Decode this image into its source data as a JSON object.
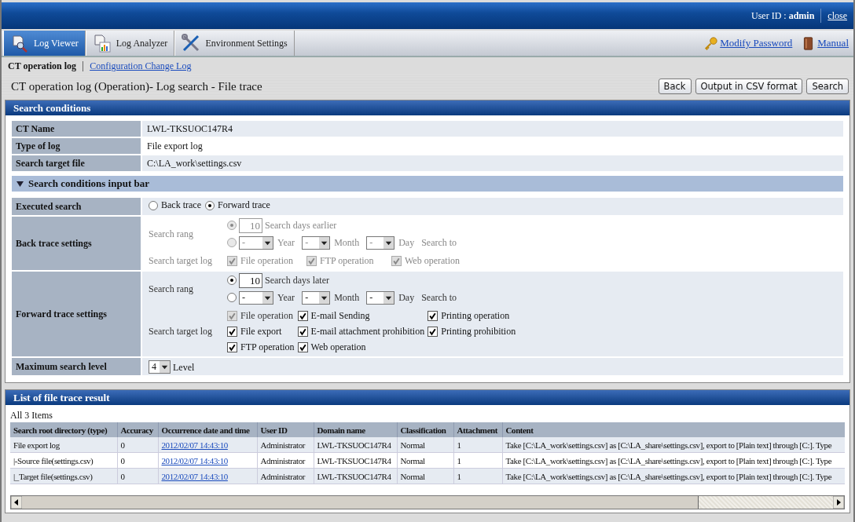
{
  "header": {
    "user_label": "User ID : ",
    "user": "admin",
    "close": "close"
  },
  "tabs": [
    {
      "label": "Log Viewer",
      "selected": true,
      "kind": "viewer"
    },
    {
      "label": "Log Analyzer",
      "selected": false,
      "kind": "analyzer"
    },
    {
      "label": "Environment Settings",
      "selected": false,
      "kind": "settings"
    }
  ],
  "links": [
    {
      "label": "Modify Password",
      "kind": "key"
    },
    {
      "label": "Manual",
      "kind": "book"
    }
  ],
  "subnav": [
    {
      "label": "CT operation log",
      "selected": true
    },
    {
      "label": "Configuration Change Log",
      "selected": false
    }
  ],
  "title": "CT operation log (Operation)- Log search - File trace",
  "buttons": [
    "Back",
    "Output in CSV format",
    "Search"
  ],
  "search_conditions": {
    "title": "Search conditions",
    "info": [
      {
        "label": "CT Name",
        "value": "LWL-TKSUOC147R4"
      },
      {
        "label": "Type of log",
        "value": "File export log"
      },
      {
        "label": "Search target file",
        "value": "C:\\LA_work\\settings.csv"
      }
    ]
  },
  "input_bar": {
    "title": "Search conditions input bar",
    "expanded": true
  },
  "executed_search": {
    "label": "Executed search",
    "options": [
      {
        "label": "Back trace",
        "selected": false
      },
      {
        "label": "Forward trace",
        "selected": true
      }
    ]
  },
  "traces": [
    {
      "label": "Back trace settings",
      "disabled": true,
      "range_label": "Search rang",
      "days_selected": true,
      "days": "10",
      "days_text": "Search days earlier",
      "date_selected": false,
      "date": [
        {
          "value": "-",
          "unit": "Year"
        },
        {
          "value": "-",
          "unit": "Month"
        },
        {
          "value": "-",
          "unit": "Day"
        }
      ],
      "search_to": "Search to",
      "target_label": "Search target log",
      "checks": [
        {
          "label": "File operation",
          "checked": true,
          "disabled": true
        },
        {
          "label": "FTP operation",
          "checked": true,
          "disabled": true
        },
        {
          "label": "Web operation",
          "checked": true,
          "disabled": true
        }
      ]
    },
    {
      "label": "Forward trace settings",
      "disabled": false,
      "range_label": "Search rang",
      "days_selected": true,
      "days": "10",
      "days_text": "Search days later",
      "date_selected": false,
      "date": [
        {
          "value": "-",
          "unit": "Year"
        },
        {
          "value": "-",
          "unit": "Month"
        },
        {
          "value": "-",
          "unit": "Day"
        }
      ],
      "search_to": "Search to",
      "target_label": "Search target log",
      "checks": [
        {
          "label": "File operation",
          "checked": true,
          "disabled": true
        },
        {
          "label": "E-mail Sending",
          "checked": true,
          "disabled": false
        },
        {
          "label": "Printing operation",
          "checked": true,
          "disabled": false
        },
        {
          "label": "File export",
          "checked": true,
          "disabled": false
        },
        {
          "label": "E-mail attachment prohibition",
          "checked": true,
          "disabled": false
        },
        {
          "label": "Printing prohibition",
          "checked": true,
          "disabled": false
        },
        {
          "label": "FTP operation",
          "checked": true,
          "disabled": false
        },
        {
          "label": "Web operation",
          "checked": true,
          "disabled": false
        }
      ]
    }
  ],
  "max_level": {
    "label": "Maximum search level",
    "value": "4",
    "unit": "Level"
  },
  "results": {
    "title": "List of file trace result",
    "count": "All 3 Items",
    "columns": [
      "Search root directory (type)",
      "Accuracy",
      "Occurrence date and time",
      "User ID",
      "Domain name",
      "Classification",
      "Attachment",
      "Content"
    ],
    "rows": [
      [
        "File export log",
        "0",
        "2012/02/07 14:43:10",
        "Administrator",
        "LWL-TKSUOC147R4",
        "Normal",
        "1",
        "Take [C:\\LA_work\\settings.csv] as [C:\\LA_share\\settings.csv], export to [Plain text] through [C:]. Type"
      ],
      [
        "|-Source file(settings.csv)",
        "0",
        "2012/02/07 14:43:10",
        "Administrator",
        "LWL-TKSUOC147R4",
        "Normal",
        "1",
        "Take [C:\\LA_work\\settings.csv] as [C:\\LA_share\\settings.csv], export to [Plain text] through [C:]. Type"
      ],
      [
        "|_Target file(settings.csv)",
        "0",
        "2012/02/07 14:43:10",
        "Administrator",
        "LWL-TKSUOC147R4",
        "Normal",
        "1",
        "Take [C:\\LA_work\\settings.csv] as [C:\\LA_share\\settings.csv], export to [Plain text] through [C:]. Type"
      ]
    ]
  }
}
